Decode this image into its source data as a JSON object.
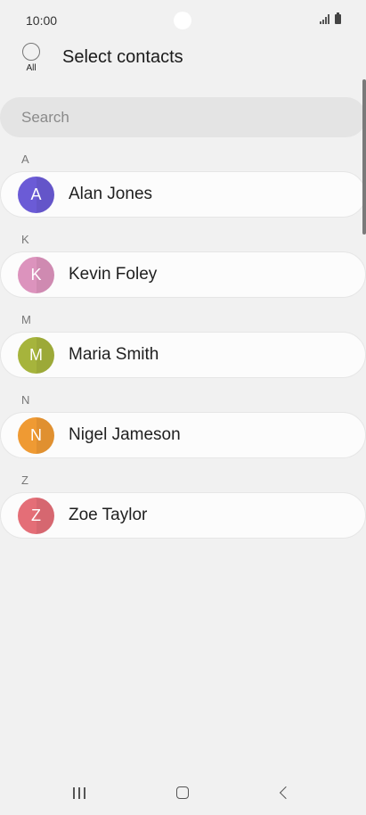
{
  "status_bar": {
    "time": "10:00"
  },
  "header": {
    "select_all_label": "All",
    "title": "Select contacts"
  },
  "search": {
    "placeholder": "Search"
  },
  "sections": [
    {
      "letter": "A",
      "contacts": [
        {
          "initial": "A",
          "name": "Alan Jones",
          "color": "#6b5bd6"
        }
      ]
    },
    {
      "letter": "K",
      "contacts": [
        {
          "initial": "K",
          "name": "Kevin Foley",
          "color": "#dc93bd"
        }
      ]
    },
    {
      "letter": "M",
      "contacts": [
        {
          "initial": "M",
          "name": "Maria Smith",
          "color": "#a6b43c"
        }
      ]
    },
    {
      "letter": "N",
      "contacts": [
        {
          "initial": "N",
          "name": "Nigel Jameson",
          "color": "#ef9a33"
        }
      ]
    },
    {
      "letter": "Z",
      "contacts": [
        {
          "initial": "Z",
          "name": "Zoe Taylor",
          "color": "#e46e77"
        }
      ]
    }
  ],
  "icons": {
    "signal": "signal-icon",
    "battery": "battery-icon",
    "nav_recents": "recents-icon",
    "nav_home": "home-icon",
    "nav_back": "back-icon"
  }
}
